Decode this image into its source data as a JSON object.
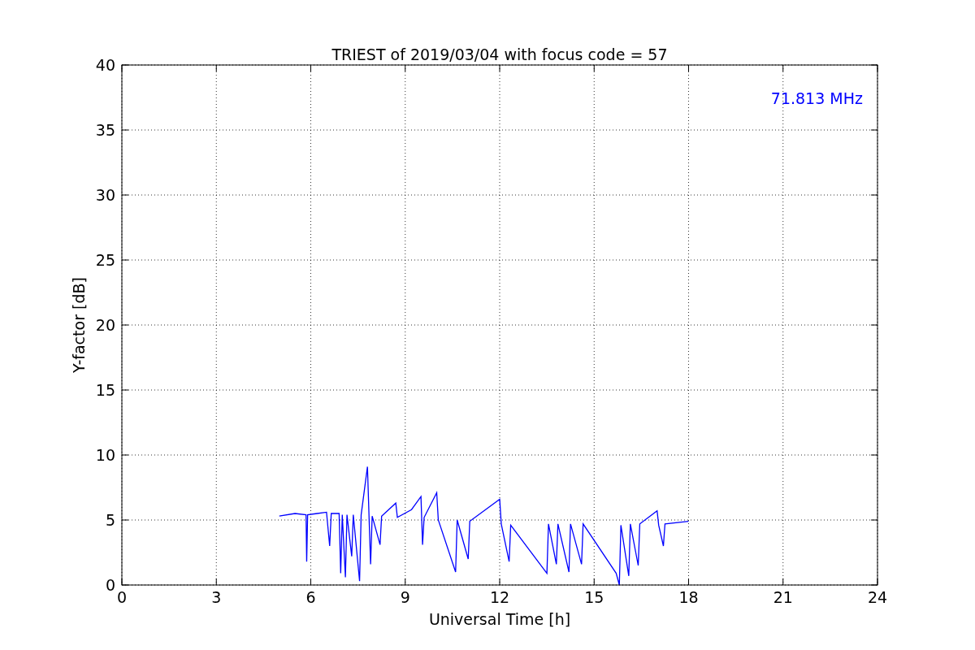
{
  "figure": {
    "chart_data": {
      "type": "line",
      "title": "TRIEST of 2019/03/04 with focus code = 57",
      "xlabel": "Universal Time [h]",
      "ylabel": "Y-factor [dB]",
      "x": [
        5.0,
        5.5,
        5.85,
        5.87,
        5.9,
        6.2,
        6.5,
        6.6,
        6.65,
        6.9,
        6.95,
        7.0,
        7.1,
        7.15,
        7.3,
        7.35,
        7.55,
        7.6,
        7.8,
        7.85,
        7.9,
        7.95,
        8.2,
        8.25,
        8.7,
        8.75,
        9.2,
        9.5,
        9.55,
        9.6,
        10.0,
        10.05,
        10.6,
        10.65,
        11.0,
        11.05,
        12.0,
        12.05,
        12.3,
        12.35,
        13.5,
        13.55,
        13.8,
        13.85,
        14.2,
        14.25,
        14.6,
        14.65,
        15.7,
        15.8,
        15.85,
        16.1,
        16.15,
        16.4,
        16.45,
        17.0,
        17.05,
        17.2,
        17.25,
        18.0
      ],
      "series": [
        {
          "name": "71.813 MHz",
          "color": "#0000ff",
          "values": [
            5.3,
            5.5,
            5.4,
            1.8,
            5.4,
            5.5,
            5.6,
            3.0,
            5.5,
            5.5,
            0.9,
            5.4,
            0.6,
            5.4,
            2.2,
            5.4,
            0.3,
            5.4,
            9.1,
            5.3,
            1.6,
            5.3,
            3.1,
            5.3,
            6.3,
            5.2,
            5.8,
            6.8,
            3.1,
            5.2,
            7.1,
            5.0,
            1.0,
            5.0,
            2.0,
            4.9,
            6.6,
            4.7,
            1.8,
            4.6,
            0.9,
            4.7,
            1.6,
            4.7,
            1.0,
            4.7,
            1.6,
            4.7,
            0.9,
            0.0,
            4.6,
            0.7,
            4.7,
            1.5,
            4.7,
            5.7,
            4.6,
            3.0,
            4.7,
            4.9
          ]
        }
      ],
      "xlim": [
        0,
        24
      ],
      "ylim": [
        0,
        40
      ],
      "xticks": [
        0,
        3,
        6,
        9,
        12,
        15,
        18,
        21,
        24
      ],
      "yticks": [
        0,
        5,
        10,
        15,
        20,
        25,
        30,
        35,
        40
      ],
      "grid": true
    }
  }
}
